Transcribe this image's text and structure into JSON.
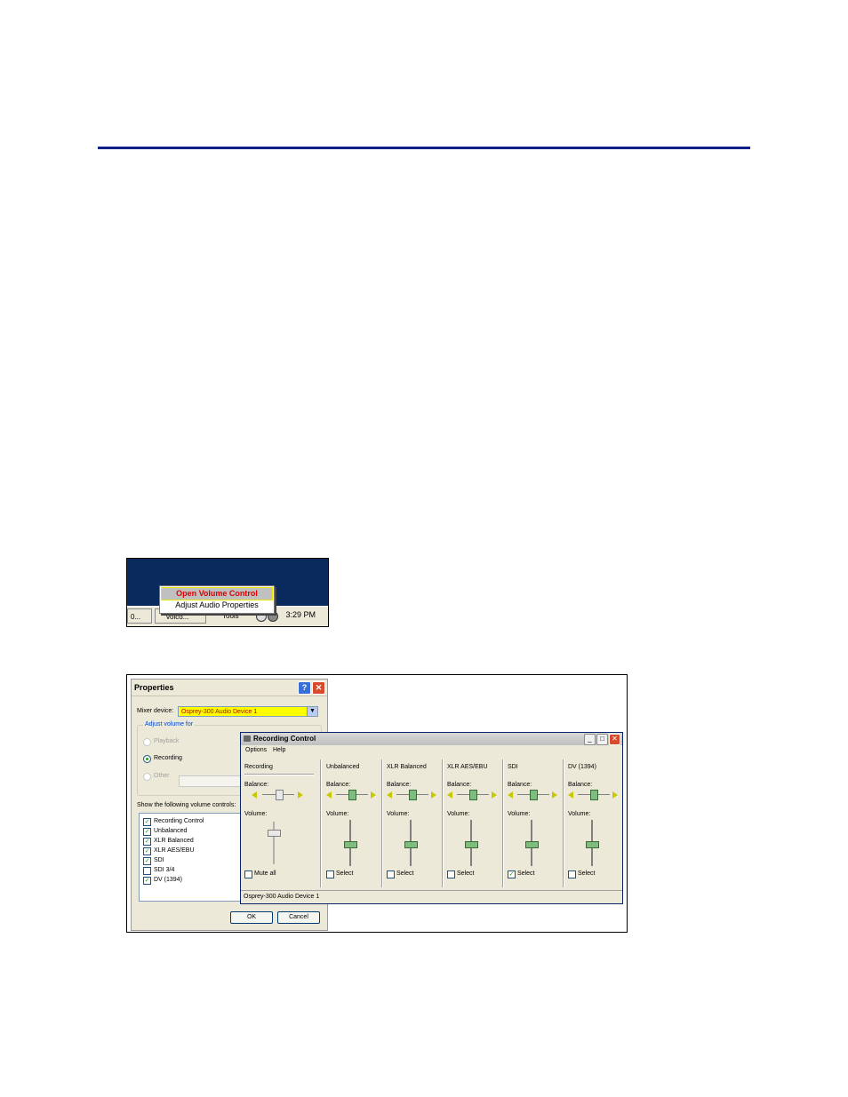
{
  "taskbar_shot": {
    "menu_items": [
      "Open Volume Control",
      "Adjust Audio Properties"
    ],
    "taskbar_buttons": [
      "0...",
      "volco...",
      "Tools"
    ],
    "clock": "3:29 PM"
  },
  "properties": {
    "title": "Properties",
    "help_glyph": "?",
    "close_glyph": "✕",
    "mixer_label": "Mixer device:",
    "mixer_value": "Osprey-300 Audio Device 1",
    "adjust_legend": "Adjust volume for",
    "radios": [
      {
        "label": "Playback",
        "checked": false,
        "enabled": false
      },
      {
        "label": "Recording",
        "checked": true,
        "enabled": true
      },
      {
        "label": "Other",
        "checked": false,
        "enabled": false
      }
    ],
    "show_label": "Show the following volume controls:",
    "controls": [
      {
        "label": "Recording Control",
        "checked": true
      },
      {
        "label": "Unbalanced",
        "checked": true
      },
      {
        "label": "XLR Balanced",
        "checked": true
      },
      {
        "label": "XLR AES/EBU",
        "checked": true
      },
      {
        "label": "SDI",
        "checked": true
      },
      {
        "label": "SDI 3/4",
        "checked": false
      },
      {
        "label": "DV (1394)",
        "checked": true
      }
    ],
    "ok_label": "OK",
    "cancel_label": "Cancel"
  },
  "recording": {
    "title": "Recording Control",
    "menus": [
      "Options",
      "Help"
    ],
    "balance_label": "Balance:",
    "volume_label": "Volume:",
    "columns": [
      {
        "name": "Recording",
        "check_label": "Mute all",
        "checked": false
      },
      {
        "name": "Unbalanced",
        "check_label": "Select",
        "checked": false
      },
      {
        "name": "XLR Balanced",
        "check_label": "Select",
        "checked": false
      },
      {
        "name": "XLR AES/EBU",
        "check_label": "Select",
        "checked": false
      },
      {
        "name": "SDI",
        "check_label": "Select",
        "checked": true
      },
      {
        "name": "DV (1394)",
        "check_label": "Select",
        "checked": false
      }
    ],
    "status": "Osprey-300 Audio Device 1"
  }
}
